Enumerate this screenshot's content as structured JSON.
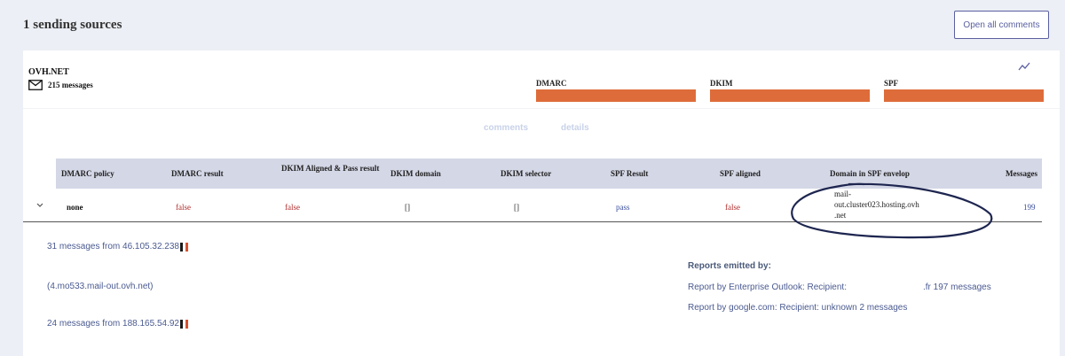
{
  "header": {
    "title": "1 sending sources",
    "open_comments_label": "Open all comments"
  },
  "source": {
    "name": "OVH.NET",
    "messages_label": "215 messages",
    "metrics": [
      {
        "label": "DMARC",
        "fill": 1.0
      },
      {
        "label": "DKIM",
        "fill": 1.0
      },
      {
        "label": "SPF",
        "fill": 1.0
      }
    ],
    "accent_color": "#de6c3a"
  },
  "tabs": [
    "comments",
    "details"
  ],
  "table": {
    "headers": [
      "DMARC policy",
      "DMARC result",
      "DKIM Aligned & Pass result",
      "DKIM domain",
      "DKIM selector",
      "SPF Result",
      "SPF aligned",
      "Domain in SPF envelop",
      "Messages"
    ],
    "row": {
      "policy": "none",
      "dmarc_result": "false",
      "dkim_aligned": "false",
      "dkim_domain": "[]",
      "dkim_selector": "[]",
      "spf_result": "pass",
      "spf_aligned": "false",
      "spf_domain_lines": [
        "mail-",
        "out.cluster023.hosting.ovh",
        ".net"
      ],
      "messages": "199"
    }
  },
  "details": {
    "ips": [
      {
        "text": "31 messages from 46.105.32.238"
      },
      {
        "text": "(4.mo533.mail-out.ovh.net)"
      },
      {
        "text": "24 messages from 188.165.54.92"
      }
    ],
    "reports_title": "Reports emitted by:",
    "reports": [
      {
        "prefix": "Report by Enterprise Outlook: Recipient:",
        "suffix": ".fr 197 messages"
      },
      {
        "text": "Report by google.com: Recipient: unknown 2 messages"
      }
    ]
  }
}
